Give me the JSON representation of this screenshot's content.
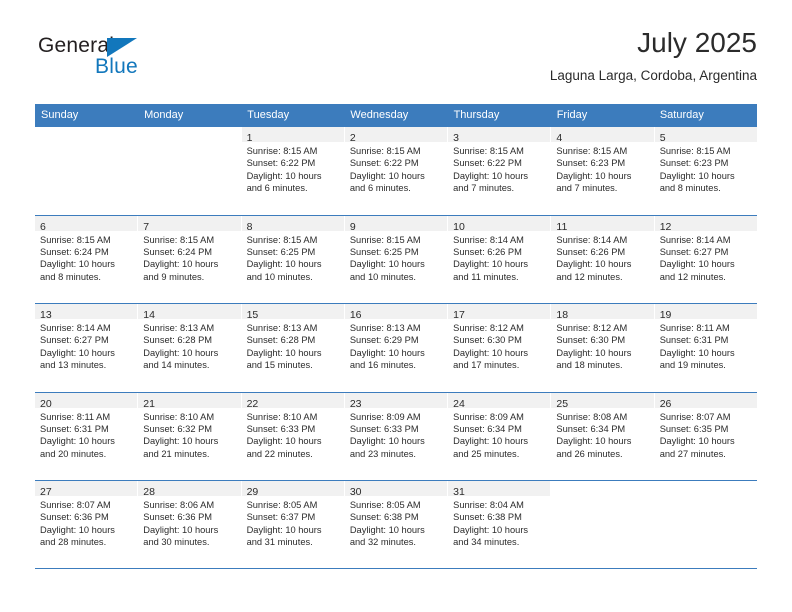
{
  "brand": {
    "name_part1": "General",
    "name_part2": "Blue",
    "triangle_icon": "triangle-icon",
    "accent_color": "#1277bc"
  },
  "header": {
    "title": "July 2025",
    "subtitle": "Laguna Larga, Cordoba, Argentina"
  },
  "theme": {
    "header_blue": "#3c7cbd",
    "day_band_gray": "#f1f1f1",
    "text_color": "#2b2b2b"
  },
  "weekdays": [
    "Sunday",
    "Monday",
    "Tuesday",
    "Wednesday",
    "Thursday",
    "Friday",
    "Saturday"
  ],
  "weeks": [
    [
      {
        "day": "",
        "sunrise": "",
        "sunset": "",
        "daylight1": "",
        "daylight2": ""
      },
      {
        "day": "",
        "sunrise": "",
        "sunset": "",
        "daylight1": "",
        "daylight2": ""
      },
      {
        "day": "1",
        "sunrise": "Sunrise: 8:15 AM",
        "sunset": "Sunset: 6:22 PM",
        "daylight1": "Daylight: 10 hours",
        "daylight2": "and 6 minutes."
      },
      {
        "day": "2",
        "sunrise": "Sunrise: 8:15 AM",
        "sunset": "Sunset: 6:22 PM",
        "daylight1": "Daylight: 10 hours",
        "daylight2": "and 6 minutes."
      },
      {
        "day": "3",
        "sunrise": "Sunrise: 8:15 AM",
        "sunset": "Sunset: 6:22 PM",
        "daylight1": "Daylight: 10 hours",
        "daylight2": "and 7 minutes."
      },
      {
        "day": "4",
        "sunrise": "Sunrise: 8:15 AM",
        "sunset": "Sunset: 6:23 PM",
        "daylight1": "Daylight: 10 hours",
        "daylight2": "and 7 minutes."
      },
      {
        "day": "5",
        "sunrise": "Sunrise: 8:15 AM",
        "sunset": "Sunset: 6:23 PM",
        "daylight1": "Daylight: 10 hours",
        "daylight2": "and 8 minutes."
      }
    ],
    [
      {
        "day": "6",
        "sunrise": "Sunrise: 8:15 AM",
        "sunset": "Sunset: 6:24 PM",
        "daylight1": "Daylight: 10 hours",
        "daylight2": "and 8 minutes."
      },
      {
        "day": "7",
        "sunrise": "Sunrise: 8:15 AM",
        "sunset": "Sunset: 6:24 PM",
        "daylight1": "Daylight: 10 hours",
        "daylight2": "and 9 minutes."
      },
      {
        "day": "8",
        "sunrise": "Sunrise: 8:15 AM",
        "sunset": "Sunset: 6:25 PM",
        "daylight1": "Daylight: 10 hours",
        "daylight2": "and 10 minutes."
      },
      {
        "day": "9",
        "sunrise": "Sunrise: 8:15 AM",
        "sunset": "Sunset: 6:25 PM",
        "daylight1": "Daylight: 10 hours",
        "daylight2": "and 10 minutes."
      },
      {
        "day": "10",
        "sunrise": "Sunrise: 8:14 AM",
        "sunset": "Sunset: 6:26 PM",
        "daylight1": "Daylight: 10 hours",
        "daylight2": "and 11 minutes."
      },
      {
        "day": "11",
        "sunrise": "Sunrise: 8:14 AM",
        "sunset": "Sunset: 6:26 PM",
        "daylight1": "Daylight: 10 hours",
        "daylight2": "and 12 minutes."
      },
      {
        "day": "12",
        "sunrise": "Sunrise: 8:14 AM",
        "sunset": "Sunset: 6:27 PM",
        "daylight1": "Daylight: 10 hours",
        "daylight2": "and 12 minutes."
      }
    ],
    [
      {
        "day": "13",
        "sunrise": "Sunrise: 8:14 AM",
        "sunset": "Sunset: 6:27 PM",
        "daylight1": "Daylight: 10 hours",
        "daylight2": "and 13 minutes."
      },
      {
        "day": "14",
        "sunrise": "Sunrise: 8:13 AM",
        "sunset": "Sunset: 6:28 PM",
        "daylight1": "Daylight: 10 hours",
        "daylight2": "and 14 minutes."
      },
      {
        "day": "15",
        "sunrise": "Sunrise: 8:13 AM",
        "sunset": "Sunset: 6:28 PM",
        "daylight1": "Daylight: 10 hours",
        "daylight2": "and 15 minutes."
      },
      {
        "day": "16",
        "sunrise": "Sunrise: 8:13 AM",
        "sunset": "Sunset: 6:29 PM",
        "daylight1": "Daylight: 10 hours",
        "daylight2": "and 16 minutes."
      },
      {
        "day": "17",
        "sunrise": "Sunrise: 8:12 AM",
        "sunset": "Sunset: 6:30 PM",
        "daylight1": "Daylight: 10 hours",
        "daylight2": "and 17 minutes."
      },
      {
        "day": "18",
        "sunrise": "Sunrise: 8:12 AM",
        "sunset": "Sunset: 6:30 PM",
        "daylight1": "Daylight: 10 hours",
        "daylight2": "and 18 minutes."
      },
      {
        "day": "19",
        "sunrise": "Sunrise: 8:11 AM",
        "sunset": "Sunset: 6:31 PM",
        "daylight1": "Daylight: 10 hours",
        "daylight2": "and 19 minutes."
      }
    ],
    [
      {
        "day": "20",
        "sunrise": "Sunrise: 8:11 AM",
        "sunset": "Sunset: 6:31 PM",
        "daylight1": "Daylight: 10 hours",
        "daylight2": "and 20 minutes."
      },
      {
        "day": "21",
        "sunrise": "Sunrise: 8:10 AM",
        "sunset": "Sunset: 6:32 PM",
        "daylight1": "Daylight: 10 hours",
        "daylight2": "and 21 minutes."
      },
      {
        "day": "22",
        "sunrise": "Sunrise: 8:10 AM",
        "sunset": "Sunset: 6:33 PM",
        "daylight1": "Daylight: 10 hours",
        "daylight2": "and 22 minutes."
      },
      {
        "day": "23",
        "sunrise": "Sunrise: 8:09 AM",
        "sunset": "Sunset: 6:33 PM",
        "daylight1": "Daylight: 10 hours",
        "daylight2": "and 23 minutes."
      },
      {
        "day": "24",
        "sunrise": "Sunrise: 8:09 AM",
        "sunset": "Sunset: 6:34 PM",
        "daylight1": "Daylight: 10 hours",
        "daylight2": "and 25 minutes."
      },
      {
        "day": "25",
        "sunrise": "Sunrise: 8:08 AM",
        "sunset": "Sunset: 6:34 PM",
        "daylight1": "Daylight: 10 hours",
        "daylight2": "and 26 minutes."
      },
      {
        "day": "26",
        "sunrise": "Sunrise: 8:07 AM",
        "sunset": "Sunset: 6:35 PM",
        "daylight1": "Daylight: 10 hours",
        "daylight2": "and 27 minutes."
      }
    ],
    [
      {
        "day": "27",
        "sunrise": "Sunrise: 8:07 AM",
        "sunset": "Sunset: 6:36 PM",
        "daylight1": "Daylight: 10 hours",
        "daylight2": "and 28 minutes."
      },
      {
        "day": "28",
        "sunrise": "Sunrise: 8:06 AM",
        "sunset": "Sunset: 6:36 PM",
        "daylight1": "Daylight: 10 hours",
        "daylight2": "and 30 minutes."
      },
      {
        "day": "29",
        "sunrise": "Sunrise: 8:05 AM",
        "sunset": "Sunset: 6:37 PM",
        "daylight1": "Daylight: 10 hours",
        "daylight2": "and 31 minutes."
      },
      {
        "day": "30",
        "sunrise": "Sunrise: 8:05 AM",
        "sunset": "Sunset: 6:38 PM",
        "daylight1": "Daylight: 10 hours",
        "daylight2": "and 32 minutes."
      },
      {
        "day": "31",
        "sunrise": "Sunrise: 8:04 AM",
        "sunset": "Sunset: 6:38 PM",
        "daylight1": "Daylight: 10 hours",
        "daylight2": "and 34 minutes."
      },
      {
        "day": "",
        "sunrise": "",
        "sunset": "",
        "daylight1": "",
        "daylight2": ""
      },
      {
        "day": "",
        "sunrise": "",
        "sunset": "",
        "daylight1": "",
        "daylight2": ""
      }
    ]
  ]
}
